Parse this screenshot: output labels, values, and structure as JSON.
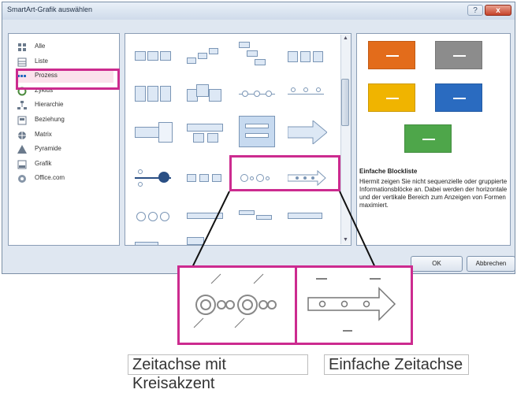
{
  "window": {
    "title": "SmartArt-Grafik auswählen",
    "help": "?",
    "close": "x"
  },
  "categories": [
    {
      "label": "Alle",
      "icon": "all-icon"
    },
    {
      "label": "Liste",
      "icon": "list-icon"
    },
    {
      "label": "Prozess",
      "icon": "process-icon",
      "selected": true
    },
    {
      "label": "Zyklus",
      "icon": "cycle-icon"
    },
    {
      "label": "Hierarchie",
      "icon": "hierarchy-icon"
    },
    {
      "label": "Beziehung",
      "icon": "relationship-icon"
    },
    {
      "label": "Matrix",
      "icon": "matrix-icon"
    },
    {
      "label": "Pyramide",
      "icon": "pyramid-icon"
    },
    {
      "label": "Grafik",
      "icon": "picture-icon"
    },
    {
      "label": "Office.com",
      "icon": "globe-icon"
    }
  ],
  "preview": {
    "title": "Einfache Blockliste",
    "description": "Hiermit zeigen Sie nicht sequenzielle oder gruppierte Informationsblöcke an. Dabei werden der horizontale und der vertikale Bereich zum Anzeigen von Formen maximiert.",
    "tile_colors": [
      "#e36c1b",
      "#8c8c8c",
      "#f0b400",
      "#2a6bc0",
      "#4ea64a"
    ]
  },
  "buttons": {
    "ok": "OK",
    "cancel": "Abbrechen"
  },
  "callouts": [
    {
      "caption": "Zeitachse mit Kreisakzent"
    },
    {
      "caption": "Einfache Zeitachse"
    }
  ],
  "colors": {
    "highlight": "#cc2b8f"
  }
}
